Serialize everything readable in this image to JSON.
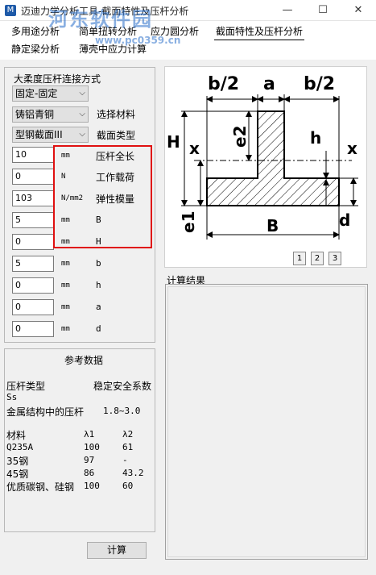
{
  "window": {
    "title": "迈迪力学分析工具-截面特性及压杆分析",
    "app_icon": "M",
    "minimize_glyph": "—",
    "maximize_glyph": "☐",
    "close_glyph": "✕"
  },
  "watermark": {
    "text": "河东软件园",
    "url": "www.pc0359.cn"
  },
  "tabs": [
    {
      "label": "多用途分析"
    },
    {
      "label": "简单扭转分析"
    },
    {
      "label": "应力圆分析"
    },
    {
      "label": "截面特性及压杆分析"
    },
    {
      "label": "静定梁分析"
    },
    {
      "label": "薄壳中应力计算"
    }
  ],
  "left_panel": {
    "connection_label": "大柔度压杆连接方式",
    "connection_value": "固定-固定",
    "material_value": "铸铝青铜",
    "material_label": "选择材料",
    "section_value": "型钢截面III",
    "section_label": "截面类型",
    "params": [
      {
        "value": "10",
        "unit": "mm",
        "name": "压杆全长"
      },
      {
        "value": "0",
        "unit": "N",
        "name": "工作载荷"
      },
      {
        "value": "103",
        "unit": "N/mm2",
        "name": "弹性模量"
      },
      {
        "value": "5",
        "unit": "mm",
        "name": "B"
      },
      {
        "value": "0",
        "unit": "mm",
        "name": "H"
      },
      {
        "value": "5",
        "unit": "mm",
        "name": "b"
      },
      {
        "value": "0",
        "unit": "mm",
        "name": "h"
      },
      {
        "value": "0",
        "unit": "mm",
        "name": "a"
      },
      {
        "value": "0",
        "unit": "mm",
        "name": "d"
      }
    ]
  },
  "reference": {
    "title": "参考数据",
    "col1_header": "压杆类型",
    "col2_header": "稳定安全系数",
    "ss_label": "Ss",
    "metal_label": "金属结构中的压杆",
    "metal_value": "1.8~3.0",
    "material_header": "材料",
    "lambda1_header": "λ1",
    "lambda2_header": "λ2",
    "rows": [
      {
        "name": "Q235A",
        "l1": "100",
        "l2": "61"
      },
      {
        "name": "35钢",
        "l1": "97",
        "l2": "-"
      },
      {
        "name": "45钢",
        "l1": "86",
        "l2": "43.2"
      },
      {
        "name": "优质碳钢、硅钢",
        "l1": "100",
        "l2": "60"
      }
    ]
  },
  "calc_button": "计算",
  "diagram": {
    "labels": {
      "b_half_left": "b/2",
      "a": "a",
      "b_half_right": "b/2",
      "H": "H",
      "x_left": "x",
      "e2": "e2",
      "h": "h",
      "x_right": "x",
      "e1": "e1",
      "B": "B",
      "d": "d"
    },
    "pages": [
      "1",
      "2",
      "3"
    ]
  },
  "result": {
    "label": "计算结果"
  }
}
